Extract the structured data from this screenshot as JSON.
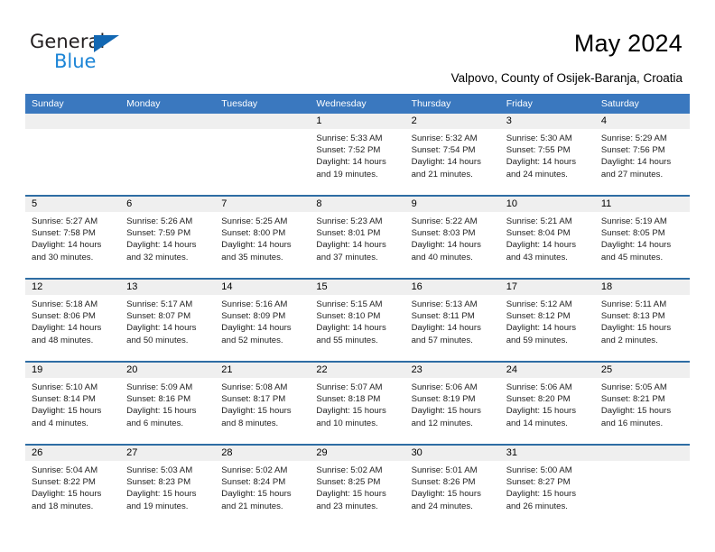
{
  "brand": {
    "name_part1": "General",
    "name_part2": "Blue",
    "accent_color": "#1b84d6",
    "triangle_color": "#1267b2"
  },
  "header": {
    "title": "May 2024",
    "subtitle": "Valpovo, County of Osijek-Baranja, Croatia"
  },
  "calendar": {
    "header_bg": "#3a78bf",
    "header_text_color": "#ffffff",
    "daynum_bg": "#efefef",
    "row_separator_color": "#2e6da4",
    "weekday_headers": [
      "Sunday",
      "Monday",
      "Tuesday",
      "Wednesday",
      "Thursday",
      "Friday",
      "Saturday"
    ],
    "weeks": [
      [
        {
          "day": "",
          "sunrise": "",
          "sunset": "",
          "daylight_line1": "",
          "daylight_line2": ""
        },
        {
          "day": "",
          "sunrise": "",
          "sunset": "",
          "daylight_line1": "",
          "daylight_line2": ""
        },
        {
          "day": "",
          "sunrise": "",
          "sunset": "",
          "daylight_line1": "",
          "daylight_line2": ""
        },
        {
          "day": "1",
          "sunrise": "Sunrise: 5:33 AM",
          "sunset": "Sunset: 7:52 PM",
          "daylight_line1": "Daylight: 14 hours",
          "daylight_line2": "and 19 minutes."
        },
        {
          "day": "2",
          "sunrise": "Sunrise: 5:32 AM",
          "sunset": "Sunset: 7:54 PM",
          "daylight_line1": "Daylight: 14 hours",
          "daylight_line2": "and 21 minutes."
        },
        {
          "day": "3",
          "sunrise": "Sunrise: 5:30 AM",
          "sunset": "Sunset: 7:55 PM",
          "daylight_line1": "Daylight: 14 hours",
          "daylight_line2": "and 24 minutes."
        },
        {
          "day": "4",
          "sunrise": "Sunrise: 5:29 AM",
          "sunset": "Sunset: 7:56 PM",
          "daylight_line1": "Daylight: 14 hours",
          "daylight_line2": "and 27 minutes."
        }
      ],
      [
        {
          "day": "5",
          "sunrise": "Sunrise: 5:27 AM",
          "sunset": "Sunset: 7:58 PM",
          "daylight_line1": "Daylight: 14 hours",
          "daylight_line2": "and 30 minutes."
        },
        {
          "day": "6",
          "sunrise": "Sunrise: 5:26 AM",
          "sunset": "Sunset: 7:59 PM",
          "daylight_line1": "Daylight: 14 hours",
          "daylight_line2": "and 32 minutes."
        },
        {
          "day": "7",
          "sunrise": "Sunrise: 5:25 AM",
          "sunset": "Sunset: 8:00 PM",
          "daylight_line1": "Daylight: 14 hours",
          "daylight_line2": "and 35 minutes."
        },
        {
          "day": "8",
          "sunrise": "Sunrise: 5:23 AM",
          "sunset": "Sunset: 8:01 PM",
          "daylight_line1": "Daylight: 14 hours",
          "daylight_line2": "and 37 minutes."
        },
        {
          "day": "9",
          "sunrise": "Sunrise: 5:22 AM",
          "sunset": "Sunset: 8:03 PM",
          "daylight_line1": "Daylight: 14 hours",
          "daylight_line2": "and 40 minutes."
        },
        {
          "day": "10",
          "sunrise": "Sunrise: 5:21 AM",
          "sunset": "Sunset: 8:04 PM",
          "daylight_line1": "Daylight: 14 hours",
          "daylight_line2": "and 43 minutes."
        },
        {
          "day": "11",
          "sunrise": "Sunrise: 5:19 AM",
          "sunset": "Sunset: 8:05 PM",
          "daylight_line1": "Daylight: 14 hours",
          "daylight_line2": "and 45 minutes."
        }
      ],
      [
        {
          "day": "12",
          "sunrise": "Sunrise: 5:18 AM",
          "sunset": "Sunset: 8:06 PM",
          "daylight_line1": "Daylight: 14 hours",
          "daylight_line2": "and 48 minutes."
        },
        {
          "day": "13",
          "sunrise": "Sunrise: 5:17 AM",
          "sunset": "Sunset: 8:07 PM",
          "daylight_line1": "Daylight: 14 hours",
          "daylight_line2": "and 50 minutes."
        },
        {
          "day": "14",
          "sunrise": "Sunrise: 5:16 AM",
          "sunset": "Sunset: 8:09 PM",
          "daylight_line1": "Daylight: 14 hours",
          "daylight_line2": "and 52 minutes."
        },
        {
          "day": "15",
          "sunrise": "Sunrise: 5:15 AM",
          "sunset": "Sunset: 8:10 PM",
          "daylight_line1": "Daylight: 14 hours",
          "daylight_line2": "and 55 minutes."
        },
        {
          "day": "16",
          "sunrise": "Sunrise: 5:13 AM",
          "sunset": "Sunset: 8:11 PM",
          "daylight_line1": "Daylight: 14 hours",
          "daylight_line2": "and 57 minutes."
        },
        {
          "day": "17",
          "sunrise": "Sunrise: 5:12 AM",
          "sunset": "Sunset: 8:12 PM",
          "daylight_line1": "Daylight: 14 hours",
          "daylight_line2": "and 59 minutes."
        },
        {
          "day": "18",
          "sunrise": "Sunrise: 5:11 AM",
          "sunset": "Sunset: 8:13 PM",
          "daylight_line1": "Daylight: 15 hours",
          "daylight_line2": "and 2 minutes."
        }
      ],
      [
        {
          "day": "19",
          "sunrise": "Sunrise: 5:10 AM",
          "sunset": "Sunset: 8:14 PM",
          "daylight_line1": "Daylight: 15 hours",
          "daylight_line2": "and 4 minutes."
        },
        {
          "day": "20",
          "sunrise": "Sunrise: 5:09 AM",
          "sunset": "Sunset: 8:16 PM",
          "daylight_line1": "Daylight: 15 hours",
          "daylight_line2": "and 6 minutes."
        },
        {
          "day": "21",
          "sunrise": "Sunrise: 5:08 AM",
          "sunset": "Sunset: 8:17 PM",
          "daylight_line1": "Daylight: 15 hours",
          "daylight_line2": "and 8 minutes."
        },
        {
          "day": "22",
          "sunrise": "Sunrise: 5:07 AM",
          "sunset": "Sunset: 8:18 PM",
          "daylight_line1": "Daylight: 15 hours",
          "daylight_line2": "and 10 minutes."
        },
        {
          "day": "23",
          "sunrise": "Sunrise: 5:06 AM",
          "sunset": "Sunset: 8:19 PM",
          "daylight_line1": "Daylight: 15 hours",
          "daylight_line2": "and 12 minutes."
        },
        {
          "day": "24",
          "sunrise": "Sunrise: 5:06 AM",
          "sunset": "Sunset: 8:20 PM",
          "daylight_line1": "Daylight: 15 hours",
          "daylight_line2": "and 14 minutes."
        },
        {
          "day": "25",
          "sunrise": "Sunrise: 5:05 AM",
          "sunset": "Sunset: 8:21 PM",
          "daylight_line1": "Daylight: 15 hours",
          "daylight_line2": "and 16 minutes."
        }
      ],
      [
        {
          "day": "26",
          "sunrise": "Sunrise: 5:04 AM",
          "sunset": "Sunset: 8:22 PM",
          "daylight_line1": "Daylight: 15 hours",
          "daylight_line2": "and 18 minutes."
        },
        {
          "day": "27",
          "sunrise": "Sunrise: 5:03 AM",
          "sunset": "Sunset: 8:23 PM",
          "daylight_line1": "Daylight: 15 hours",
          "daylight_line2": "and 19 minutes."
        },
        {
          "day": "28",
          "sunrise": "Sunrise: 5:02 AM",
          "sunset": "Sunset: 8:24 PM",
          "daylight_line1": "Daylight: 15 hours",
          "daylight_line2": "and 21 minutes."
        },
        {
          "day": "29",
          "sunrise": "Sunrise: 5:02 AM",
          "sunset": "Sunset: 8:25 PM",
          "daylight_line1": "Daylight: 15 hours",
          "daylight_line2": "and 23 minutes."
        },
        {
          "day": "30",
          "sunrise": "Sunrise: 5:01 AM",
          "sunset": "Sunset: 8:26 PM",
          "daylight_line1": "Daylight: 15 hours",
          "daylight_line2": "and 24 minutes."
        },
        {
          "day": "31",
          "sunrise": "Sunrise: 5:00 AM",
          "sunset": "Sunset: 8:27 PM",
          "daylight_line1": "Daylight: 15 hours",
          "daylight_line2": "and 26 minutes."
        },
        {
          "day": "",
          "sunrise": "",
          "sunset": "",
          "daylight_line1": "",
          "daylight_line2": ""
        }
      ]
    ]
  }
}
